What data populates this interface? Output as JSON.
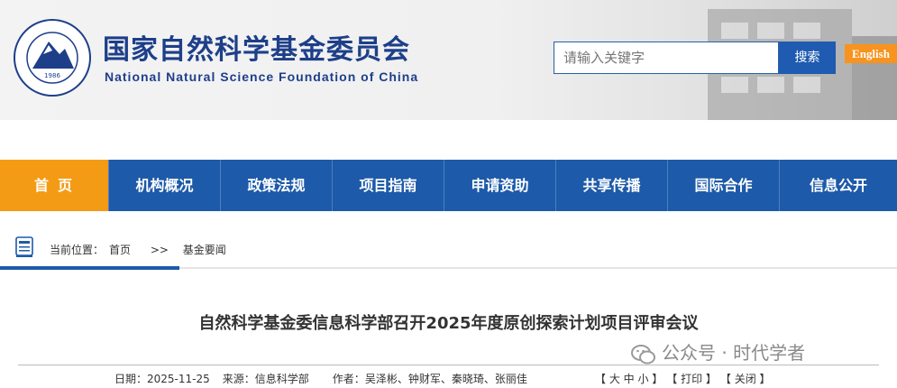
{
  "header": {
    "name_cn": "国家自然科学基金委员会",
    "name_en": "National Natural Science Foundation of China",
    "logo_year": "1986",
    "search_placeholder": "请输入关键字",
    "search_button": "搜索",
    "english_link": "English"
  },
  "nav": {
    "items": [
      "首页",
      "机构概况",
      "政策法规",
      "项目指南",
      "申请资助",
      "共享传播",
      "国际合作",
      "信息公开"
    ]
  },
  "breadcrumb": {
    "prefix": "当前位置：",
    "home": "首页",
    "separator": ">>",
    "current": "基金要闻"
  },
  "article": {
    "title": "自然科学基金委信息科学部召开2025年度原创探索计划项目评审会议",
    "date_label": "日期：",
    "date": "2025-11-25",
    "source_label": "来源：",
    "source": "信息科学部",
    "author_label": "作者：",
    "authors": "吴泽彬、钟财军、秦晓琦、张丽佳",
    "font_size": "【 大 中 小 】",
    "print": "【 打印 】",
    "close": "【 关闭 】"
  },
  "watermark": "公众号 · 时代学者",
  "colors": {
    "brand_blue": "#1d5aa9",
    "accent_orange": "#f49b16",
    "title_blue": "#1d3f8a"
  }
}
